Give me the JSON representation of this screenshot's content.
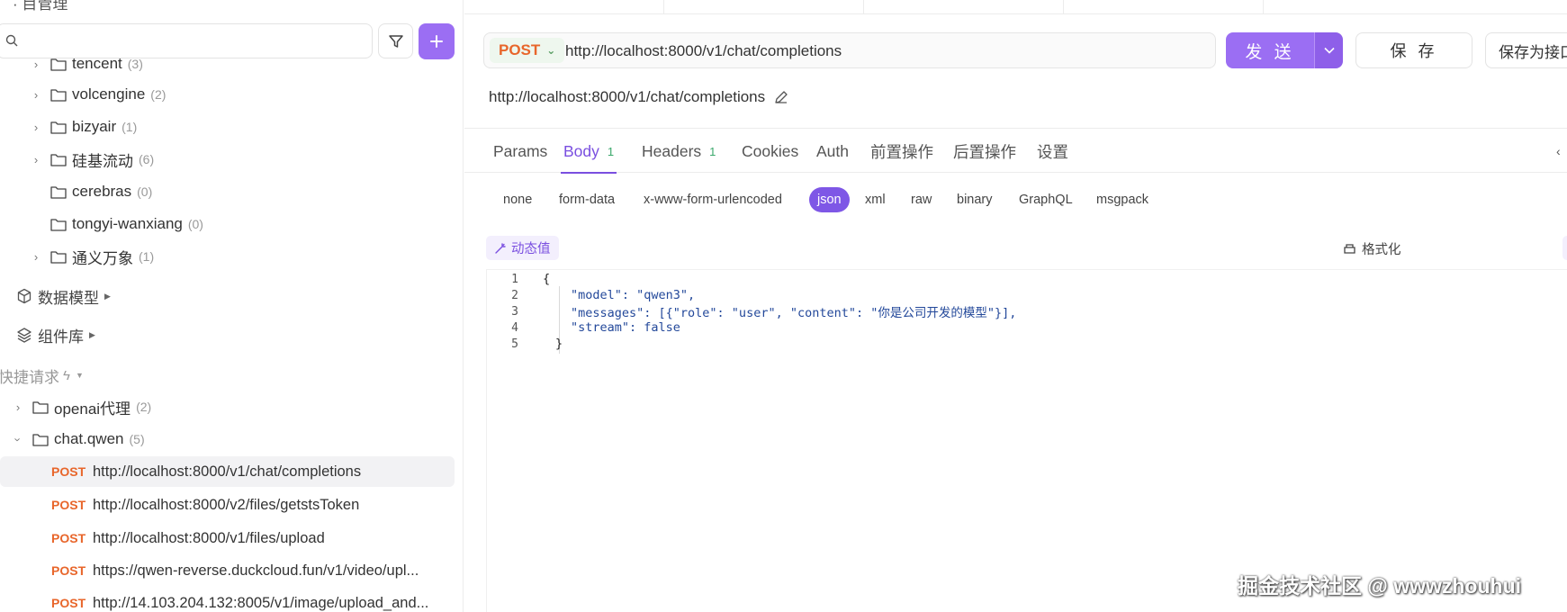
{
  "sidebar": {
    "top_clip": "· 目管理",
    "search_placeholder": "",
    "folders": [
      {
        "name": "tencent",
        "count": "(3)",
        "chevron": true
      },
      {
        "name": "volcengine",
        "count": "(2)",
        "chevron": true
      },
      {
        "name": "bizyair",
        "count": "(1)",
        "chevron": true
      },
      {
        "name": "硅基流动",
        "count": "(6)",
        "chevron": true
      },
      {
        "name": "cerebras",
        "count": "(0)",
        "chevron": false
      },
      {
        "name": "tongyi-wanxiang",
        "count": "(0)",
        "chevron": false
      },
      {
        "name": "通义万象",
        "count": "(1)",
        "chevron": true
      }
    ],
    "sections": {
      "data_model": "数据模型",
      "component_lib": "组件库",
      "quick_requests": "快捷请求"
    },
    "quick_folders": [
      {
        "name": "openai代理",
        "count": "(2)",
        "expanded": false
      },
      {
        "name": "chat.qwen",
        "count": "(5)",
        "expanded": true
      }
    ],
    "requests": [
      {
        "method": "POST",
        "url": "http://localhost:8000/v1/chat/completions",
        "active": true
      },
      {
        "method": "POST",
        "url": "http://localhost:8000/v2/files/getstsToken",
        "active": false
      },
      {
        "method": "POST",
        "url": "http://localhost:8000/v1/files/upload",
        "active": false
      },
      {
        "method": "POST",
        "url": "https://qwen-reverse.duckcloud.fun/v1/video/upl...",
        "active": false
      },
      {
        "method": "POST",
        "url": "http://14.103.204.132:8005/v1/image/upload_and...",
        "active": false
      }
    ]
  },
  "request": {
    "method": "POST",
    "url": "http://localhost:8000/v1/chat/completions",
    "send_label": "发 送",
    "save_label": "保 存",
    "save_as_label": "保存为接口",
    "display_url": "http://localhost:8000/v1/chat/completions"
  },
  "tabs": [
    {
      "label": "Params",
      "badge": ""
    },
    {
      "label": "Body",
      "badge": "1"
    },
    {
      "label": "Headers",
      "badge": "1"
    },
    {
      "label": "Cookies",
      "badge": ""
    },
    {
      "label": "Auth",
      "badge": ""
    },
    {
      "label": "前置操作",
      "badge": ""
    },
    {
      "label": "后置操作",
      "badge": ""
    },
    {
      "label": "设置",
      "badge": ""
    }
  ],
  "active_tab": "Body",
  "body_types": [
    "none",
    "form-data",
    "x-www-form-urlencoded",
    "json",
    "xml",
    "raw",
    "binary",
    "GraphQL",
    "msgpack"
  ],
  "active_body_type": "json",
  "editor": {
    "dynamic_value_label": "动态值",
    "format_label": "格式化",
    "line_numbers": [
      "1",
      "2",
      "3",
      "4",
      "5"
    ],
    "lines": [
      "{",
      "\"model\": \"qwen3\",",
      "\"messages\": [{\"role\": \"user\", \"content\": \"你是公司开发的模型\"}],",
      "\"stream\": false",
      "}"
    ]
  },
  "watermark": "掘金技术社区 @ wwwzhouhui",
  "colors": {
    "accent": "#9b6ef3",
    "method_post": "#e8662b",
    "badge_green": "#3aa86b"
  }
}
